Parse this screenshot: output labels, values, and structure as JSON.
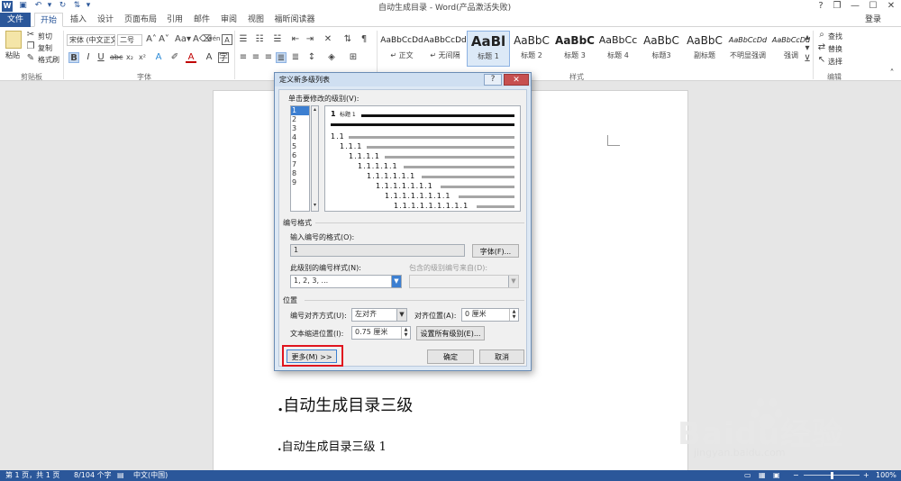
{
  "titlebar": {
    "title": "自动生成目录 - Word(产品激活失败)",
    "help": "?",
    "restore": "❐",
    "minimize": "—",
    "maximize": "☐",
    "close": "✕"
  },
  "tabs": [
    "文件",
    "开始",
    "插入",
    "设计",
    "页面布局",
    "引用",
    "邮件",
    "审阅",
    "视图",
    "福昕阅读器"
  ],
  "login": "登录",
  "ribbon": {
    "clipboard": {
      "paste": "粘贴",
      "cut": "剪切",
      "copy": "复制",
      "format_painter": "格式刷",
      "label": "剪贴板"
    },
    "font": {
      "name": "宋体 (中文正文)",
      "size": "二号",
      "label": "字体",
      "wen": "wén",
      "A": "A"
    },
    "paragraph": {
      "label": "段落"
    },
    "styles": {
      "label": "样式",
      "items": [
        {
          "sample": "AaBbCcDd",
          "name": "↵ 正文"
        },
        {
          "sample": "AaBbCcDd",
          "name": "↵ 无间隔"
        },
        {
          "sample": "AaBl",
          "name": "标题 1"
        },
        {
          "sample": "AaBbC",
          "name": "标题 2"
        },
        {
          "sample": "AaBbC",
          "name": "标题 3"
        },
        {
          "sample": "AaBbCc",
          "name": "标题 4"
        },
        {
          "sample": "AaBbC",
          "name": "标题3"
        },
        {
          "sample": "AaBbC",
          "name": "副标题"
        },
        {
          "sample": "AaBbCcDd",
          "name": "不明显强调"
        },
        {
          "sample": "AaBbCcDd",
          "name": "强调"
        }
      ]
    },
    "editing": {
      "find": "查找",
      "replace": "替换",
      "select": "选择",
      "label": "编辑"
    }
  },
  "document": {
    "heading1": "自动生成目录三级",
    "heading2": "自动生成目录三级 1"
  },
  "statusbar": {
    "page": "第 1 页，共 1 页",
    "words": "8/104 个字",
    "lang": "中文(中国)",
    "zoom": "100%"
  },
  "dialog": {
    "title": "定义新多级列表",
    "help": "?",
    "close": "✕",
    "level_prompt": "单击要修改的级别(V):",
    "levels": [
      "1",
      "2",
      "3",
      "4",
      "5",
      "6",
      "7",
      "8",
      "9"
    ],
    "preview": {
      "first_num": "1",
      "first_label": "标题 1",
      "rows": [
        "1.1",
        "1.1.1",
        "1.1.1.1",
        "1.1.1.1.1",
        "1.1.1.1.1.1",
        "1.1.1.1.1.1.1",
        "1.1.1.1.1.1.1.1",
        "1.1.1.1.1.1.1.1.1"
      ]
    },
    "number_format_group": "编号格式",
    "enter_format_label": "输入编号的格式(O):",
    "format_value": "1",
    "font_button": "字体(F)...",
    "number_style_label": "此级别的编号样式(N):",
    "number_style_value": "1, 2, 3, ...",
    "include_from_label": "包含的级别编号来自(D):",
    "position_group": "位置",
    "alignment_label": "编号对齐方式(U):",
    "alignment_value": "左对齐",
    "align_at_label": "对齐位置(A):",
    "align_at_value": "0 厘米",
    "indent_label": "文本缩进位置(I):",
    "indent_value": "0.75 厘米",
    "set_all_button": "设置所有级别(E)...",
    "more_button": "更多(M) >>",
    "ok_button": "确定",
    "cancel_button": "取消"
  },
  "watermark": {
    "brand": "Baidu经验",
    "url": "jingyan.baidu.com"
  },
  "colors": {
    "accent": "#2b579a",
    "highlight": "#e0141e"
  }
}
